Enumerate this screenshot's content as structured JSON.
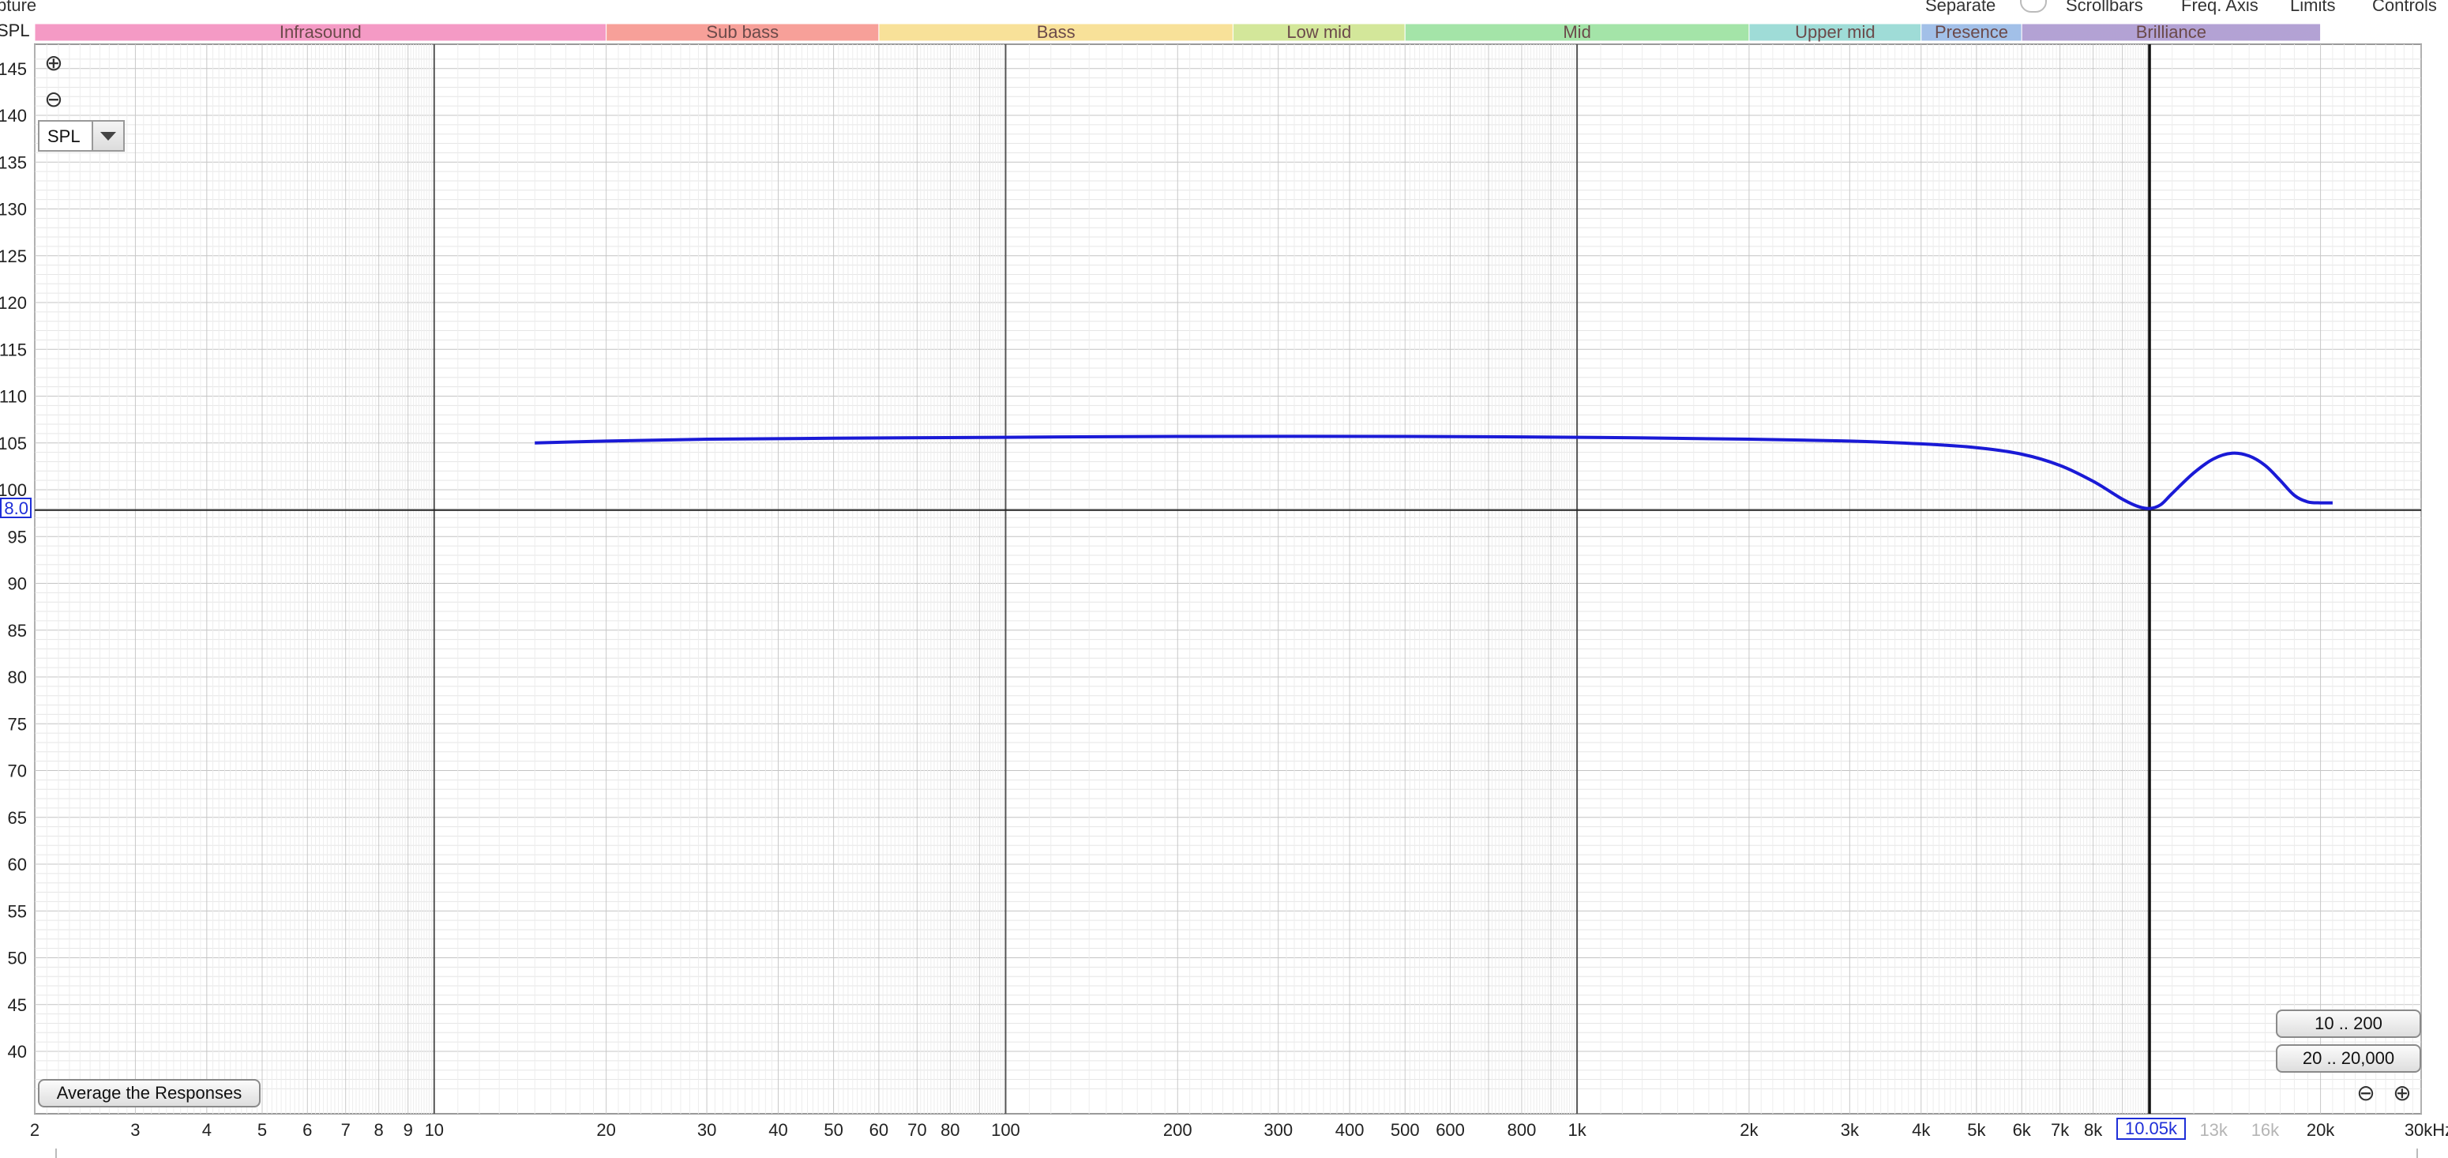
{
  "topbar": {
    "left_label": "pture",
    "separate_label": "Separate",
    "scrollbars_label": "Scrollbars",
    "freq_axis_label": "Freq. Axis",
    "limits_label": "Limits",
    "controls_label": "Controls"
  },
  "bands": [
    {
      "name": "Infrasound",
      "from": 2,
      "to": 20,
      "color": "#f49ac5"
    },
    {
      "name": "Sub bass",
      "from": 20,
      "to": 60,
      "color": "#f7a099"
    },
    {
      "name": "Bass",
      "from": 60,
      "to": 250,
      "color": "#f8e199"
    },
    {
      "name": "Low mid",
      "from": 250,
      "to": 500,
      "color": "#d3e79a"
    },
    {
      "name": "Mid",
      "from": 500,
      "to": 2000,
      "color": "#a4e4a8"
    },
    {
      "name": "Upper mid",
      "from": 2000,
      "to": 4000,
      "color": "#9fdcd7"
    },
    {
      "name": "Presence",
      "from": 4000,
      "to": 6000,
      "color": "#a2c0e8"
    },
    {
      "name": "Brilliance",
      "from": 6000,
      "to": 20000,
      "color": "#b3a2d4"
    }
  ],
  "controls": {
    "zoom_in_icon": "⊕",
    "zoom_out_icon": "⊖",
    "mode_value": "SPL",
    "average_button": "Average the Responses",
    "range_button_1": "10 .. 200",
    "range_button_2": "20 .. 20,000",
    "h_zoom_out_icon": "⊖",
    "h_zoom_in_icon": "⊕"
  },
  "cursor": {
    "y_readout": "8.0",
    "x_readout": "10.05k"
  },
  "chart_data": {
    "type": "line",
    "ylabel": "SPL",
    "xlabel": "kHz",
    "xscale": "log",
    "xlim": [
      2,
      30000
    ],
    "ylim": [
      35,
      146
    ],
    "grid": true,
    "y_ticks": [
      {
        "v": 145,
        "label": "145"
      },
      {
        "v": 140,
        "label": "140"
      },
      {
        "v": 135,
        "label": "135"
      },
      {
        "v": 130,
        "label": "130"
      },
      {
        "v": 125,
        "label": "125"
      },
      {
        "v": 120,
        "label": "120"
      },
      {
        "v": 115,
        "label": "115"
      },
      {
        "v": 110,
        "label": "110"
      },
      {
        "v": 105,
        "label": "105"
      },
      {
        "v": 100,
        "label": "100"
      },
      {
        "v": 95,
        "label": "95"
      },
      {
        "v": 90,
        "label": "90"
      },
      {
        "v": 85,
        "label": "85"
      },
      {
        "v": 80,
        "label": "80"
      },
      {
        "v": 75,
        "label": "75"
      },
      {
        "v": 70,
        "label": "70"
      },
      {
        "v": 65,
        "label": "65"
      },
      {
        "v": 60,
        "label": "60"
      },
      {
        "v": 55,
        "label": "55"
      },
      {
        "v": 50,
        "label": "50"
      },
      {
        "v": 45,
        "label": "45"
      },
      {
        "v": 40,
        "label": "40"
      }
    ],
    "x_ticks": [
      {
        "v": 2,
        "label": "2"
      },
      {
        "v": 3,
        "label": "3"
      },
      {
        "v": 4,
        "label": "4"
      },
      {
        "v": 5,
        "label": "5"
      },
      {
        "v": 6,
        "label": "6"
      },
      {
        "v": 7,
        "label": "7"
      },
      {
        "v": 8,
        "label": "8"
      },
      {
        "v": 9,
        "label": "9"
      },
      {
        "v": 10,
        "label": "10"
      },
      {
        "v": 20,
        "label": "20"
      },
      {
        "v": 30,
        "label": "30"
      },
      {
        "v": 40,
        "label": "40"
      },
      {
        "v": 50,
        "label": "50"
      },
      {
        "v": 60,
        "label": "60"
      },
      {
        "v": 70,
        "label": "70"
      },
      {
        "v": 80,
        "label": "80"
      },
      {
        "v": 100,
        "label": "100"
      },
      {
        "v": 200,
        "label": "200"
      },
      {
        "v": 300,
        "label": "300"
      },
      {
        "v": 400,
        "label": "400"
      },
      {
        "v": 500,
        "label": "500"
      },
      {
        "v": 600,
        "label": "600"
      },
      {
        "v": 800,
        "label": "800"
      },
      {
        "v": 1000,
        "label": "1k"
      },
      {
        "v": 2000,
        "label": "2k"
      },
      {
        "v": 3000,
        "label": "3k"
      },
      {
        "v": 4000,
        "label": "4k"
      },
      {
        "v": 5000,
        "label": "5k"
      },
      {
        "v": 6000,
        "label": "6k"
      },
      {
        "v": 7000,
        "label": "7k"
      },
      {
        "v": 8000,
        "label": "8k"
      },
      {
        "v": 13000,
        "label": "13k",
        "faded": true
      },
      {
        "v": 16000,
        "label": "16k",
        "faded": true
      },
      {
        "v": 20000,
        "label": "20k"
      },
      {
        "v": 30000,
        "label": "30kHz"
      }
    ],
    "cursor_x": 10050,
    "cursor_y": 98,
    "series": [
      {
        "color": "#1a1ad6",
        "points": [
          [
            15,
            105.0
          ],
          [
            20,
            105.2
          ],
          [
            30,
            105.4
          ],
          [
            50,
            105.5
          ],
          [
            100,
            105.6
          ],
          [
            200,
            105.7
          ],
          [
            500,
            105.7
          ],
          [
            1000,
            105.6
          ],
          [
            2000,
            105.4
          ],
          [
            3000,
            105.2
          ],
          [
            4000,
            104.9
          ],
          [
            5000,
            104.5
          ],
          [
            6000,
            103.8
          ],
          [
            7000,
            102.6
          ],
          [
            8000,
            100.9
          ],
          [
            9000,
            99.0
          ],
          [
            9600,
            98.2
          ],
          [
            10050,
            98.0
          ],
          [
            10500,
            98.4
          ],
          [
            11000,
            99.6
          ],
          [
            12000,
            101.8
          ],
          [
            13000,
            103.3
          ],
          [
            14000,
            103.9
          ],
          [
            15000,
            103.6
          ],
          [
            16000,
            102.6
          ],
          [
            17000,
            101.0
          ],
          [
            18000,
            99.4
          ],
          [
            19000,
            98.7
          ],
          [
            20000,
            98.6
          ],
          [
            21000,
            98.6
          ]
        ]
      }
    ]
  }
}
